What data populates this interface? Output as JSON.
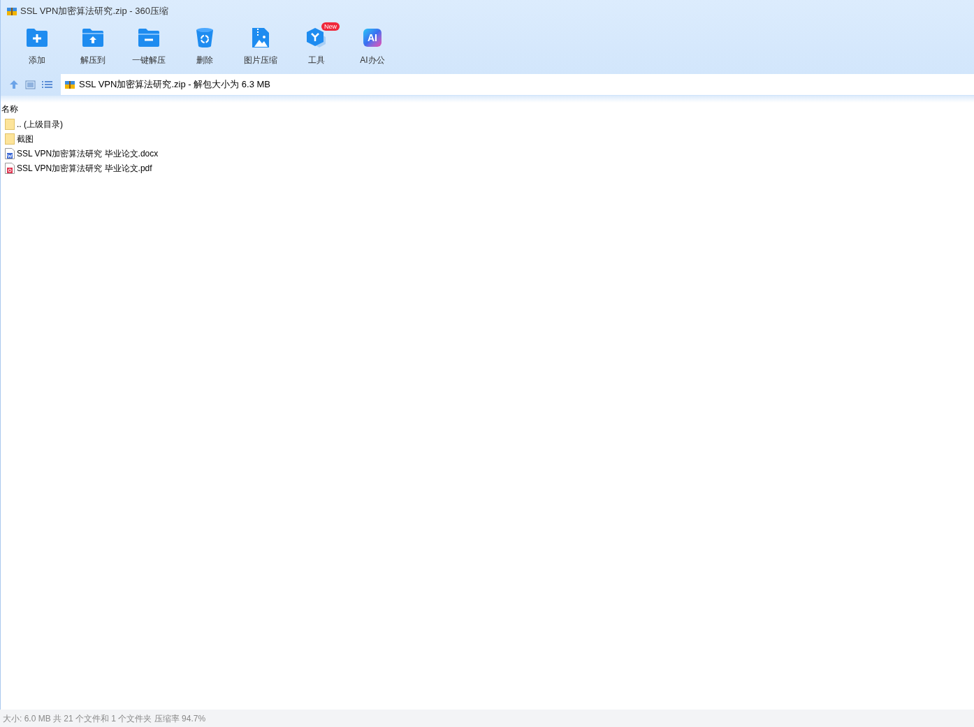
{
  "window": {
    "title": "SSL VPN加密算法研究.zip - 360压缩"
  },
  "toolbar": [
    {
      "kind": "add",
      "label": "添加"
    },
    {
      "kind": "extract",
      "label": "解压到"
    },
    {
      "kind": "oneclick",
      "label": "一键解压"
    },
    {
      "kind": "delete",
      "label": "删除"
    },
    {
      "kind": "image",
      "label": "图片压缩"
    },
    {
      "kind": "tools",
      "label": "工具",
      "badge": "New"
    },
    {
      "kind": "ai",
      "label": "AI办公",
      "icon_text": "AI"
    }
  ],
  "address_bar": {
    "path": "SSL VPN加密算法研究.zip - 解包大小为 6.3 MB"
  },
  "file_list": {
    "columns": [
      "名称"
    ],
    "rows": [
      {
        "kind": "folder",
        "name": ".. (上级目录)"
      },
      {
        "kind": "folder",
        "name": "截图"
      },
      {
        "kind": "docx",
        "name": "SSL VPN加密算法研究 毕业论文.docx"
      },
      {
        "kind": "pdf",
        "name": "SSL VPN加密算法研究 毕业论文.pdf"
      }
    ]
  },
  "status_bar": "大小: 6.0 MB 共 21 个文件和 1 个文件夹 压缩率 94.7%"
}
